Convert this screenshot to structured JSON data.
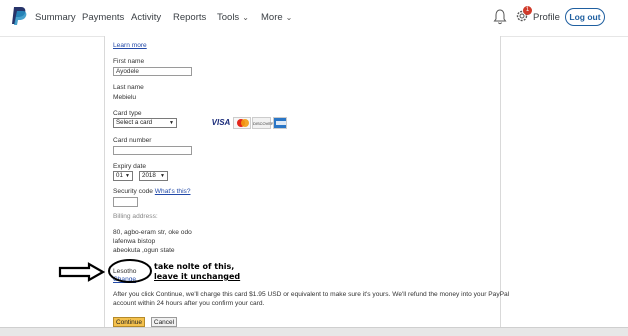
{
  "nav": {
    "summary": "Summary",
    "payments": "Payments",
    "activity": "Activity",
    "reports": "Reports",
    "tools": "Tools",
    "more": "More",
    "profile": "Profile",
    "logout": "Log out",
    "notification_count": "1"
  },
  "form": {
    "learn_more": "Learn more",
    "first_name_label": "First name",
    "first_name_value": "Ayodele",
    "last_name_label": "Last name",
    "last_name_value": "Mebielu",
    "card_type_label": "Card type",
    "card_type_value": "Select a card",
    "card_number_label": "Card number",
    "card_number_value": "",
    "expiry_label": "Expiry date",
    "expiry_month": "01",
    "expiry_year": "2018",
    "security_code_label": "Security code",
    "whats_this": "What's this?",
    "security_code_value": "",
    "billing_address_label": "Billing address:",
    "billing_line1": "80, agbo-eram str, oke odo",
    "billing_line2": "lafenwa bistop",
    "billing_line3": "abeokuta ,ogun state",
    "billing_country": "Lesotho",
    "change_link": "Change",
    "disclaimer_line1": "After you click Continue, we'll charge this card $1.95 USD or equivalent to make sure it's yours. We'll refund the money into your PayPal",
    "disclaimer_line2": "account within 24 hours after you confirm your card.",
    "continue_label": "Continue",
    "cancel_label": "Cancel"
  },
  "annotation": {
    "line1": "take nolte of this,",
    "line2": "leave it unchanged"
  },
  "card_logos": {
    "visa": "VISA",
    "discover": "DISCOVER"
  },
  "colors": {
    "brand_blue": "#1f5fa0",
    "link_blue": "#2249a8",
    "continue_yellow": "#f4c14d",
    "badge_red": "#d03a2a"
  }
}
